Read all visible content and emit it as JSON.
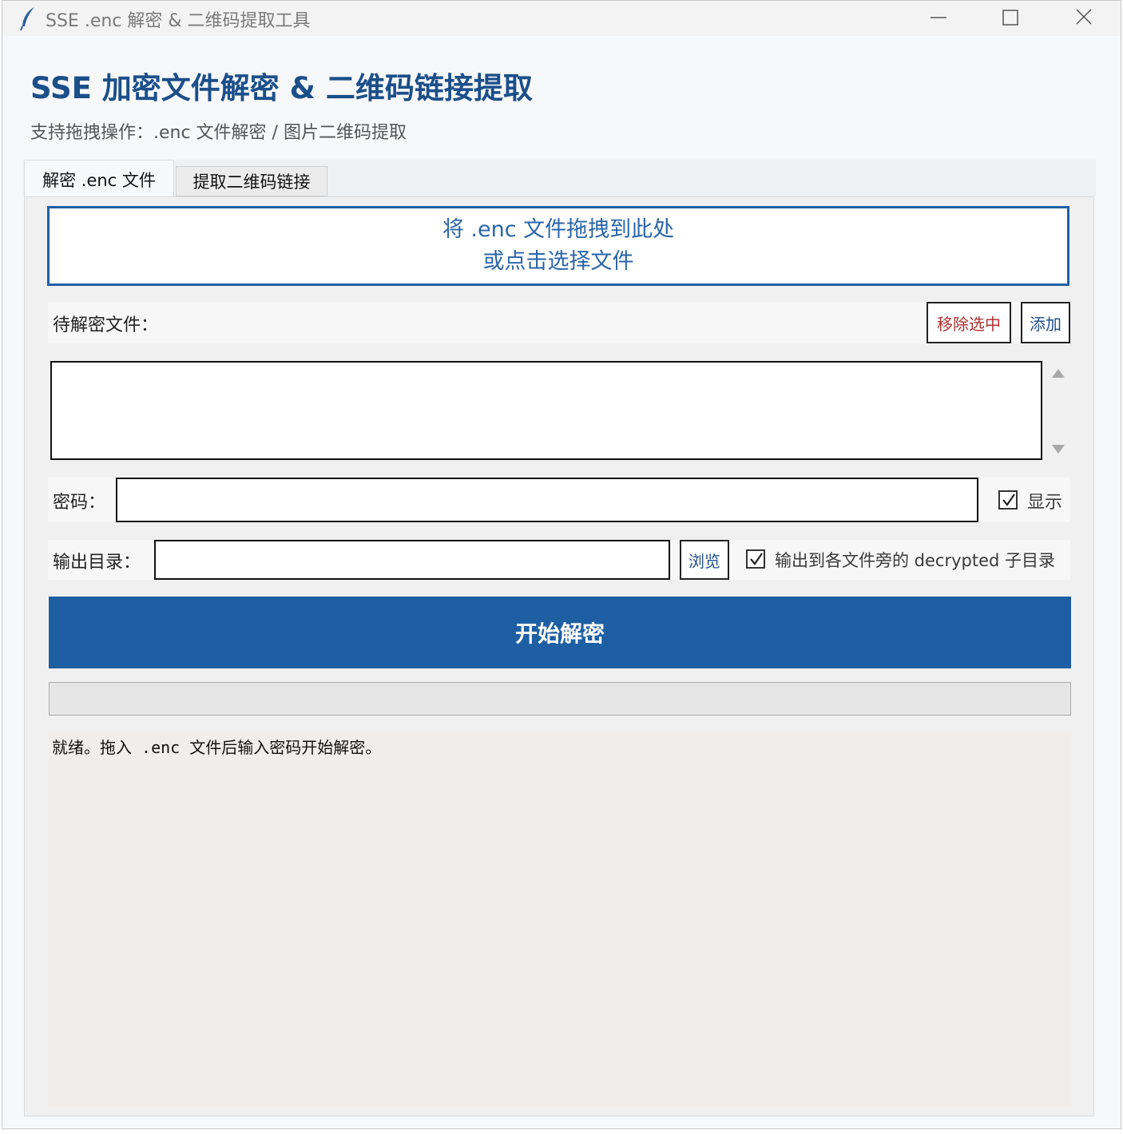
{
  "window": {
    "title": "SSE .enc 解密 & 二维码提取工具"
  },
  "header": {
    "title": "SSE 加密文件解密 & 二维码链接提取",
    "subtitle": "支持拖拽操作：.enc 文件解密 / 图片二维码提取"
  },
  "tabs": [
    {
      "label": "解密 .enc 文件",
      "active": true
    },
    {
      "label": "提取二维码链接",
      "active": false
    }
  ],
  "dropzone": {
    "line1": "将 .enc 文件拖拽到此处",
    "line2": "或点击选择文件"
  },
  "files": {
    "label": "待解密文件：",
    "remove_label": "移除选中",
    "add_label": "添加",
    "items": []
  },
  "password": {
    "label": "密码：",
    "value": "",
    "show_label": "显示",
    "show_checked": true
  },
  "output": {
    "label": "输出目录：",
    "value": "",
    "browse_label": "浏览",
    "subdir_label": "输出到各文件旁的 decrypted 子目录",
    "subdir_checked": true
  },
  "start_label": "开始解密",
  "progress_fraction": 0,
  "log_text": "就绪。拖入 .enc 文件后输入密码开始解密。",
  "colors": {
    "accent": "#1e5fa3",
    "heading": "#1b4f8a",
    "remove": "#b03030"
  }
}
